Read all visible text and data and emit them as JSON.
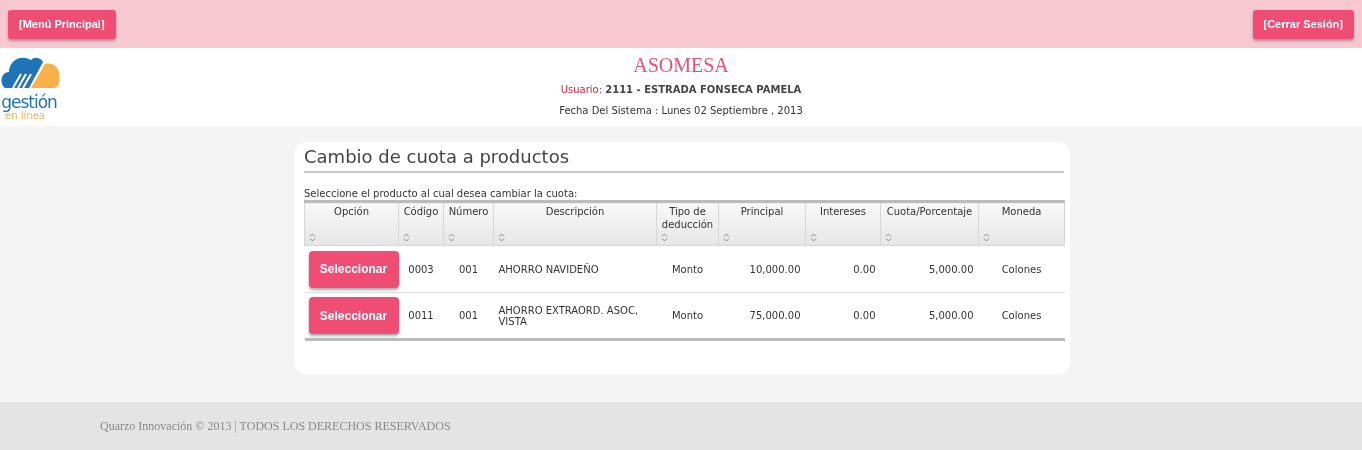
{
  "top_bar": {
    "left_button": "[Menú Principal]",
    "right_button": "[Cerrar Sesión]"
  },
  "logo": {
    "word": "gestión",
    "tagline": "en línea"
  },
  "header": {
    "title": "ASOMESA",
    "user_label": "Usuario:",
    "user_value": "2111 - ESTRADA FONSECA PAMELA",
    "date": "Fecha Del Sistema : Lunes 02 Septiembre , 2013"
  },
  "panel": {
    "title": "Cambio de cuota a productos",
    "instruction": "Seleccione el producto al cual desea cambiar la cuota:"
  },
  "table": {
    "columns": [
      "Opción",
      "Código",
      "Número",
      "Descripción",
      "Tipo de deducción",
      "Principal",
      "Intereses",
      "Cuota/Porcentaje",
      "Moneda"
    ],
    "rows": [
      {
        "cells": [
          "Seleccionar",
          "0003",
          "001",
          "AHORRO NAVIDEÑO",
          "Monto",
          "10,000.00",
          "0.00",
          "5,000.00",
          "Colones"
        ]
      },
      {
        "cells": [
          "Seleccionar",
          "0011",
          "001",
          "AHORRO EXTRAORD. ASOC, VISTA",
          "Monto",
          "75,000.00",
          "0.00",
          "5,000.00",
          "Colones"
        ]
      }
    ]
  },
  "footer": {
    "company": "Quarzo Innovación © 2013",
    "separator": "|",
    "rights": "TODOS LOS DERECHOS RESERVADOS"
  }
}
